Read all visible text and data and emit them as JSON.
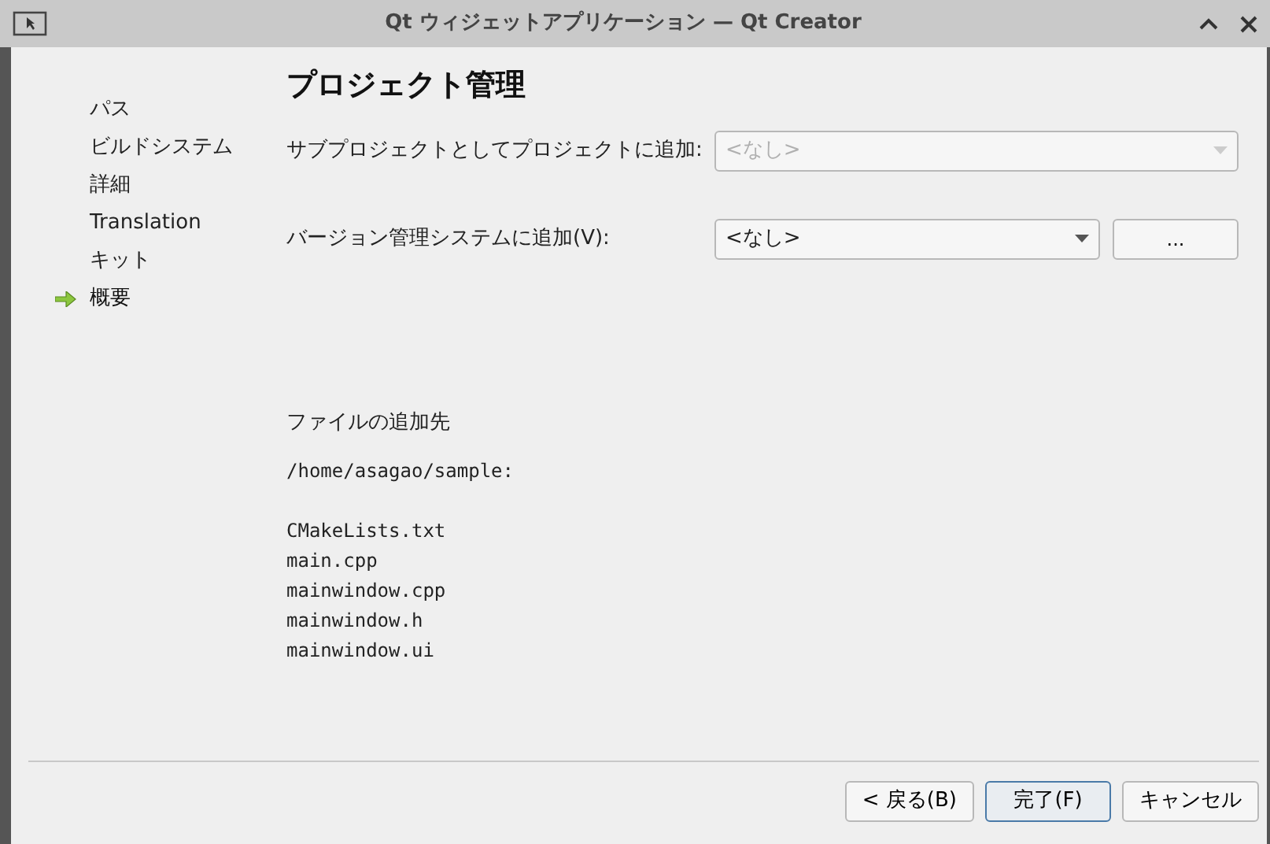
{
  "window": {
    "title": "Qt ウィジェットアプリケーション — Qt Creator"
  },
  "sidebar": {
    "items": [
      {
        "label": "パス",
        "selected": false
      },
      {
        "label": "ビルドシステム",
        "selected": false
      },
      {
        "label": "詳細",
        "selected": false
      },
      {
        "label": "Translation",
        "selected": false
      },
      {
        "label": "キット",
        "selected": false
      },
      {
        "label": "概要",
        "selected": true
      }
    ]
  },
  "page": {
    "heading": "プロジェクト管理",
    "fields": [
      {
        "label": "サブプロジェクトとしてプロジェクトに追加:",
        "value": "<なし>",
        "disabled": true
      },
      {
        "label": "バージョン管理システムに追加(V):",
        "value": "<なし>",
        "disabled": false,
        "button": "..."
      }
    ],
    "files_heading": "ファイルの追加先",
    "directory": "/home/asagao/sample:",
    "files": [
      "CMakeLists.txt",
      "main.cpp",
      "mainwindow.cpp",
      "mainwindow.h",
      "mainwindow.ui"
    ]
  },
  "buttons": [
    {
      "label": "< 戻る(B)",
      "default": false
    },
    {
      "label": "完了(F)",
      "default": true
    },
    {
      "label": "キャンセル",
      "default": false
    }
  ]
}
